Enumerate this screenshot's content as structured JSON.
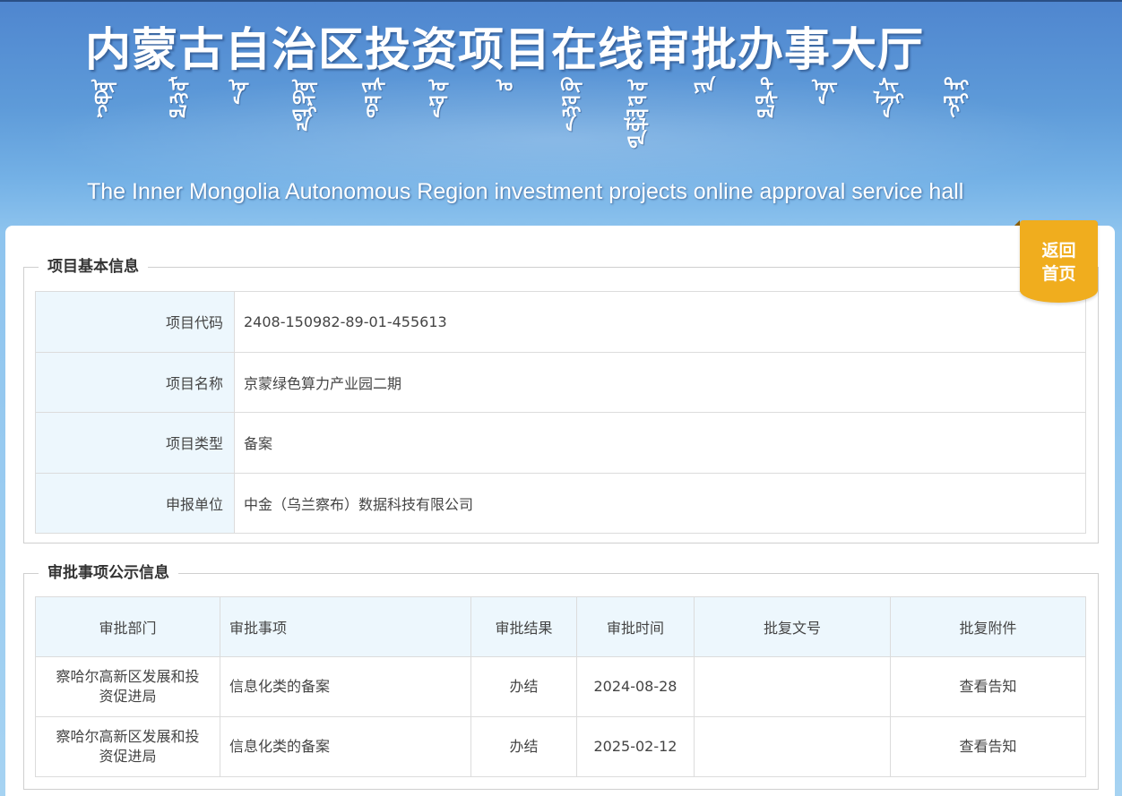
{
  "header": {
    "title_cn": "内蒙古自治区投资项目在线审批办事大厅",
    "title_mongolian": [
      "ᠥᠪᠦᠷ",
      "ᠮᠣᠩᠭᠣᠯ",
      "ᠤᠨ",
      "ᠥᠪᠡᠷᠲᠡᠭᠡᠨ",
      "ᠵᠠᠰᠠᠬᠤ",
      "ᠣᠷᠣᠨ",
      "ᠤ",
      "ᠬᠥᠷᠥᠩᠭᠡ",
      "ᠣᠷᠣᠭᠤᠯᠤᠯᠲᠠ",
      "ᠶᠢᠨ",
      "ᠲᠥᠰᠥᠯ",
      "ᠦᠨ",
      "ᠰᠢᠯᠵᠡᠭᠡ",
      "ᠳᠡᠭᠡᠷᠡᠬᠢ"
    ],
    "title_en": "The Inner Mongolia Autonomous Region investment projects online approval service hall"
  },
  "back_button": {
    "line1": "返回",
    "line2": "首页"
  },
  "basic_info": {
    "legend": "项目基本信息",
    "rows": [
      {
        "label": "项目代码",
        "value": "2408-150982-89-01-455613"
      },
      {
        "label": "项目名称",
        "value": "京蒙绿色算力产业园二期"
      },
      {
        "label": "项目类型",
        "value": "备案"
      },
      {
        "label": "申报单位",
        "value": "中金（乌兰察布）数据科技有限公司"
      }
    ]
  },
  "approval_info": {
    "legend": "审批事项公示信息",
    "headers": [
      "审批部门",
      "审批事项",
      "审批结果",
      "审批时间",
      "批复文号",
      "批复附件"
    ],
    "rows": [
      {
        "dept_line1": "察哈尔高新区发展和投",
        "dept_line2": "资促进局",
        "item": "信息化类的备案",
        "result": "办结",
        "date": "2024-08-28",
        "doc_no": "",
        "attachment": "查看告知"
      },
      {
        "dept_line1": "察哈尔高新区发展和投",
        "dept_line2": "资促进局",
        "item": "信息化类的备案",
        "result": "办结",
        "date": "2025-02-12",
        "doc_no": "",
        "attachment": "查看告知"
      }
    ]
  }
}
